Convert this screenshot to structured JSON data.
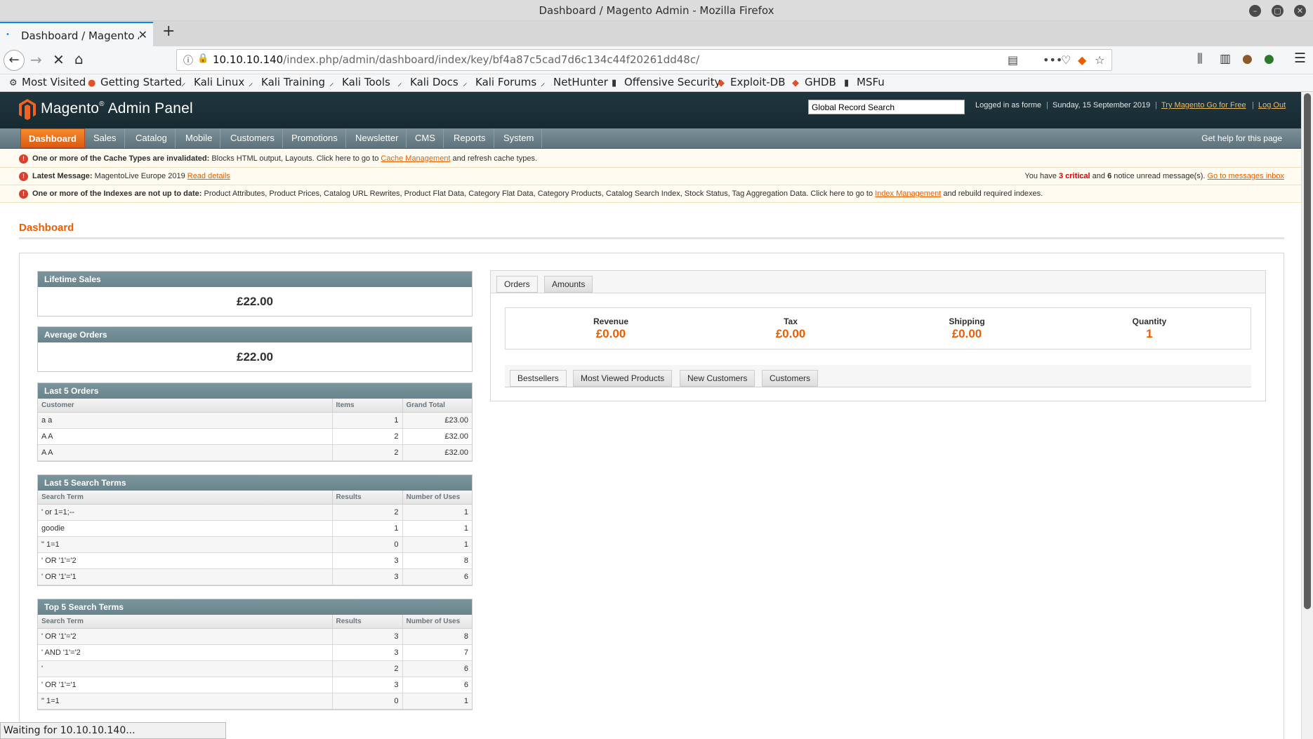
{
  "browser": {
    "window_title": "Dashboard / Magento Admin - Mozilla Firefox",
    "tab_title": "Dashboard / Magento Ad",
    "url_host": "10.10.10.140",
    "url_path": "/index.php/admin/dashboard/index/key/bf4a87c5cad7d6c134c44f20261dd48c/",
    "status_text": "Waiting for 10.10.10.140...",
    "bookmarks": [
      "Most Visited",
      "Getting Started",
      "Kali Linux",
      "Kali Training",
      "Kali Tools",
      "Kali Docs",
      "Kali Forums",
      "NetHunter",
      "Offensive Security",
      "Exploit-DB",
      "GHDB",
      "MSFu"
    ]
  },
  "header": {
    "logo": "Magento",
    "logo_suffix": "Admin Panel",
    "search_value": "Global Record Search",
    "logged_in": "Logged in as forme",
    "date": "Sunday, 15 September 2019",
    "try_link": "Try Magento Go for Free",
    "logout": "Log Out"
  },
  "nav": {
    "items": [
      "Dashboard",
      "Sales",
      "Catalog",
      "Mobile",
      "Customers",
      "Promotions",
      "Newsletter",
      "CMS",
      "Reports",
      "System"
    ],
    "active": "Dashboard",
    "help": "Get help for this page"
  },
  "notices": {
    "cache_bold": "One or more of the Cache Types are invalidated:",
    "cache_text": " Blocks HTML output, Layouts. Click here to go to ",
    "cache_link": "Cache Management",
    "cache_tail": " and refresh cache types.",
    "latest_bold": "Latest Message:",
    "latest_text": " MagentoLive Europe 2019 ",
    "latest_link": "Read details",
    "msg_pre": "You have ",
    "msg_crit": "3 critical",
    "msg_mid": " and ",
    "msg_notice": "6",
    "msg_post": " notice unread message(s). ",
    "msg_link": "Go to messages inbox",
    "index_bold": "One or more of the Indexes are not up to date:",
    "index_text": " Product Attributes, Product Prices, Catalog URL Rewrites, Product Flat Data, Category Flat Data, Category Products, Catalog Search Index, Stock Status, Tag Aggregation Data. Click here to go to ",
    "index_link": "Index Management",
    "index_tail": " and rebuild required indexes."
  },
  "dashboard": {
    "title": "Dashboard",
    "lifetime_sales_label": "Lifetime Sales",
    "lifetime_sales_value": "£22.00",
    "average_orders_label": "Average Orders",
    "average_orders_value": "£22.00",
    "last_orders": {
      "title": "Last 5 Orders",
      "headers": [
        "Customer",
        "Items",
        "Grand Total"
      ],
      "rows": [
        [
          "a a",
          "1",
          "£23.00"
        ],
        [
          "A A",
          "2",
          "£32.00"
        ],
        [
          "A A",
          "2",
          "£32.00"
        ]
      ]
    },
    "last_search": {
      "title": "Last 5 Search Terms",
      "headers": [
        "Search Term",
        "Results",
        "Number of Uses"
      ],
      "rows": [
        [
          "' or 1=1;--",
          "2",
          "1"
        ],
        [
          "goodie",
          "1",
          "1"
        ],
        [
          "\" 1=1",
          "0",
          "1"
        ],
        [
          "' OR '1'='2",
          "3",
          "8"
        ],
        [
          "' OR '1'='1",
          "3",
          "6"
        ]
      ]
    },
    "top_search": {
      "title": "Top 5 Search Terms",
      "headers": [
        "Search Term",
        "Results",
        "Number of Uses"
      ],
      "rows": [
        [
          "' OR '1'='2",
          "3",
          "8"
        ],
        [
          "' AND '1'='2",
          "3",
          "7"
        ],
        [
          "'",
          "2",
          "6"
        ],
        [
          "' OR '1'='1",
          "3",
          "6"
        ],
        [
          "\" 1=1",
          "0",
          "1"
        ]
      ]
    },
    "chart_tabs": [
      "Orders",
      "Amounts"
    ],
    "totals": [
      {
        "label": "Revenue",
        "value": "£0.00"
      },
      {
        "label": "Tax",
        "value": "£0.00"
      },
      {
        "label": "Shipping",
        "value": "£0.00"
      },
      {
        "label": "Quantity",
        "value": "1"
      }
    ],
    "grid_tabs": [
      "Bestsellers",
      "Most Viewed Products",
      "New Customers",
      "Customers"
    ]
  }
}
